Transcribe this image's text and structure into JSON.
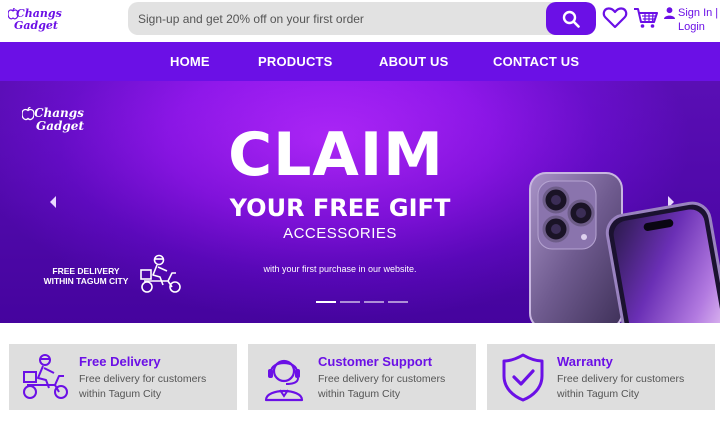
{
  "brand": {
    "logo_line1": "Changs",
    "logo_line2": "Gadget"
  },
  "search": {
    "placeholder": "Sign-up and get 20% off on your first order"
  },
  "header_icons": [
    "search-icon",
    "heart-icon",
    "cart-icon",
    "user-icon"
  ],
  "auth": {
    "sign_in": "Sign In",
    "separator": "|",
    "login": "Login"
  },
  "nav": {
    "items": [
      {
        "label": "HOME"
      },
      {
        "label": "PRODUCTS"
      },
      {
        "label": "ABOUT US"
      },
      {
        "label": "CONTACT US"
      }
    ]
  },
  "hero": {
    "logo_line1": "Changs",
    "logo_line2": "Gadget",
    "headline": "CLAIM",
    "subheadline": "YOUR FREE GIFT",
    "accessories": "ACCESSORIES",
    "purchase_note": "with your first purchase in our website.",
    "delivery_note_line1": "FREE DELIVERY",
    "delivery_note_line2": "WITHIN TAGUM CITY",
    "slide_count": 4,
    "active_slide": 1
  },
  "features": [
    {
      "icon": "delivery-scooter-icon",
      "title": "Free Delivery",
      "desc": "Free delivery for customers within Tagum City"
    },
    {
      "icon": "headset-support-icon",
      "title": "Customer Support",
      "desc": "Free delivery for customers within Tagum City"
    },
    {
      "icon": "shield-check-icon",
      "title": "Warranty",
      "desc": "Free delivery for customers within Tagum City"
    }
  ],
  "colors": {
    "accent": "#6b10e6",
    "hero_center": "#b526ff",
    "hero_edge": "#4a06a8",
    "card_bg": "#dedede",
    "search_bg": "#e2e2e2"
  }
}
